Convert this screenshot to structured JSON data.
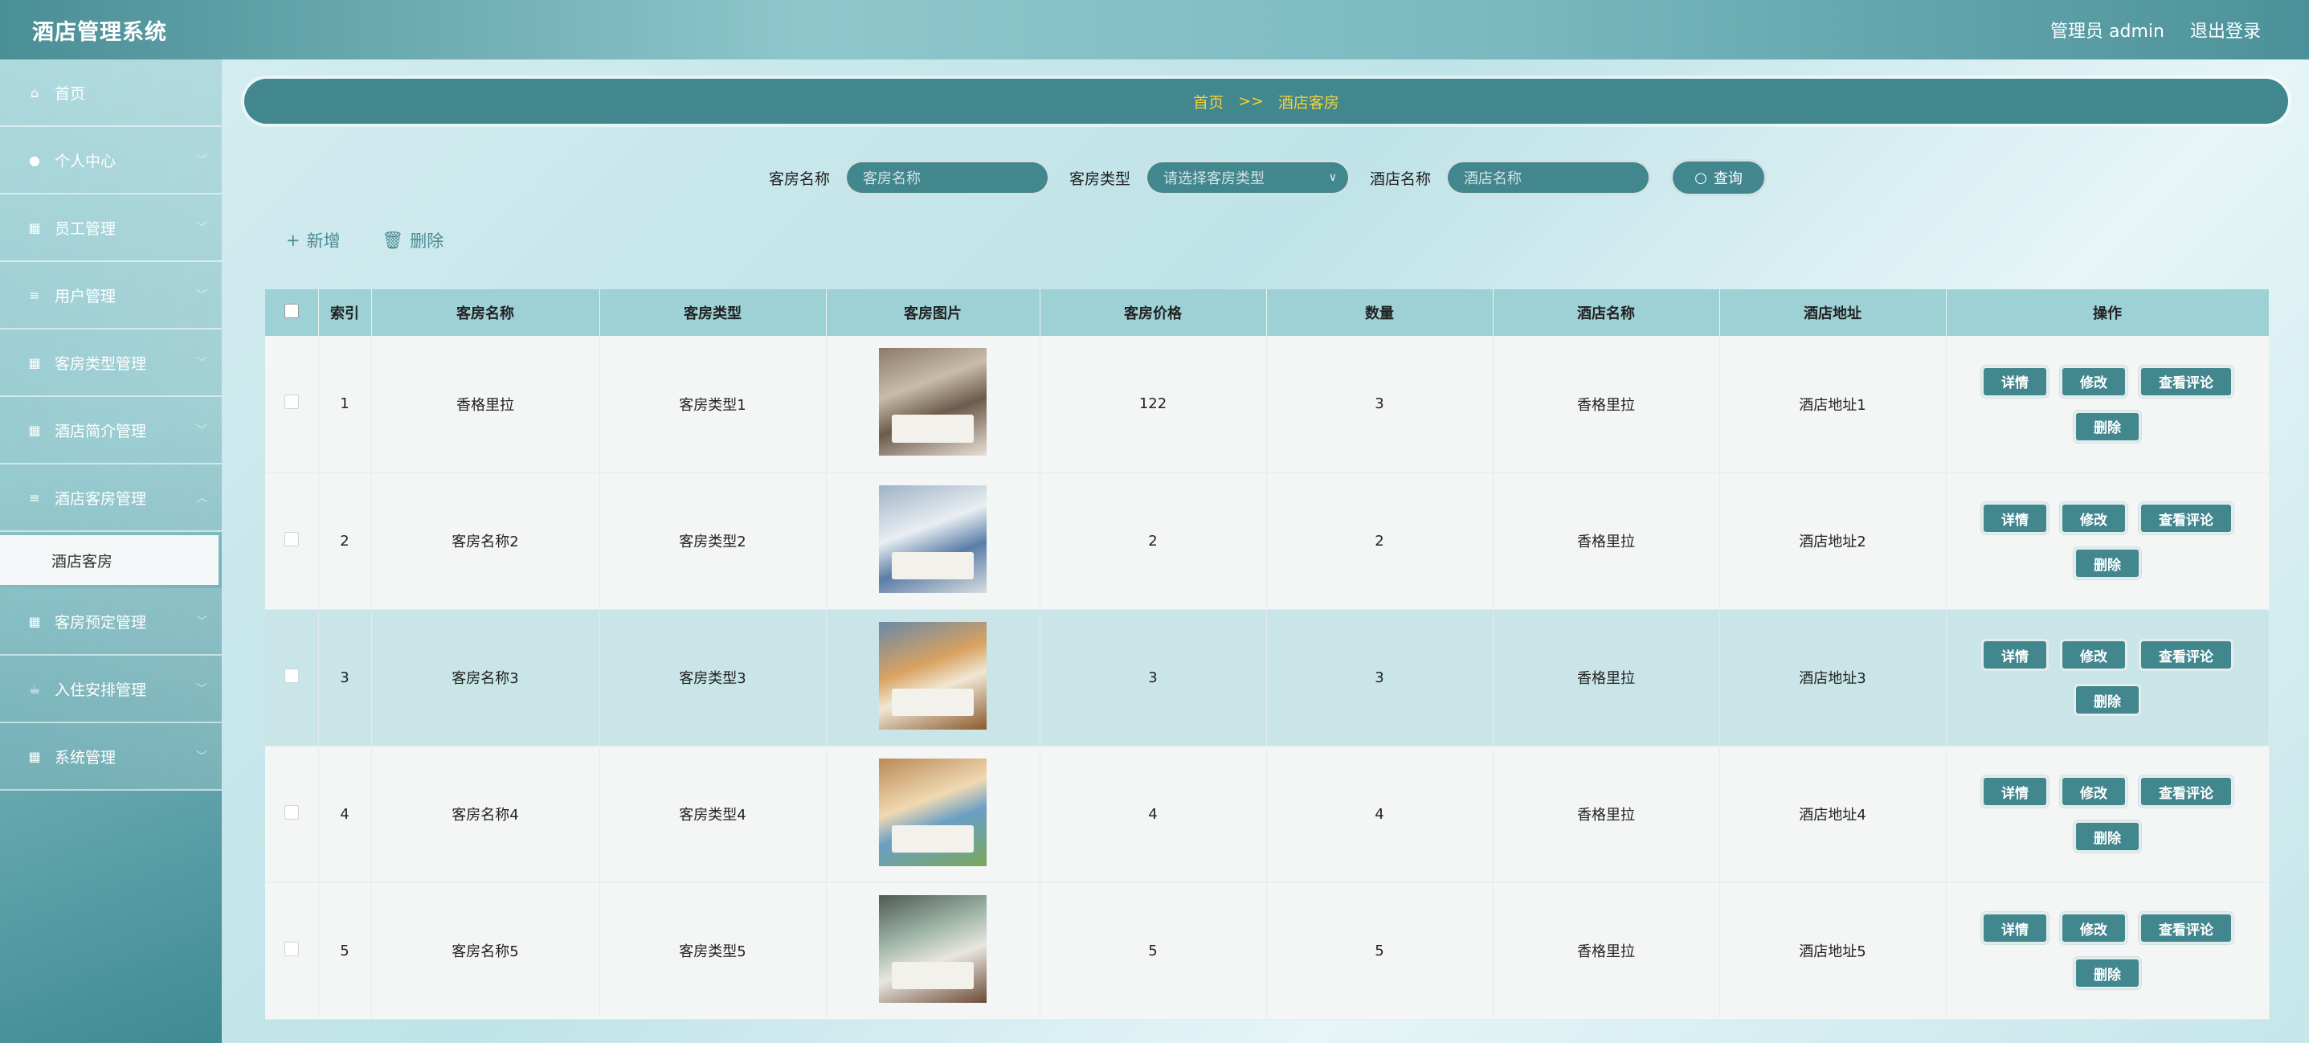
{
  "header": {
    "app_title": "酒店管理系统",
    "user_label": "管理员 admin",
    "logout_label": "退出登录"
  },
  "sidebar": {
    "items": [
      {
        "label": "首页",
        "icon": "home-icon"
      },
      {
        "label": "个人中心",
        "icon": "user-icon"
      },
      {
        "label": "员工管理",
        "icon": "grid-icon"
      },
      {
        "label": "用户管理",
        "icon": "list-icon"
      },
      {
        "label": "客房类型管理",
        "icon": "grid-icon"
      },
      {
        "label": "酒店简介管理",
        "icon": "grid-icon"
      },
      {
        "label": "酒店客房管理",
        "icon": "list-icon"
      },
      {
        "label": "客房预定管理",
        "icon": "grid-icon"
      },
      {
        "label": "入住安排管理",
        "icon": "cup-icon"
      },
      {
        "label": "系统管理",
        "icon": "grid-icon"
      }
    ],
    "active_sub": "酒店客房"
  },
  "breadcrumb": {
    "home": "首页",
    "sep": ">>",
    "current": "酒店客房"
  },
  "search": {
    "room_name_label": "客房名称",
    "room_name_placeholder": "客房名称",
    "room_type_label": "客房类型",
    "room_type_placeholder": "请选择客房类型",
    "hotel_name_label": "酒店名称",
    "hotel_name_placeholder": "酒店名称",
    "query_label": "查询"
  },
  "toolbar": {
    "add_label": "新增",
    "delete_label": "删除"
  },
  "table": {
    "headers": [
      "索引",
      "客房名称",
      "客房类型",
      "客房图片",
      "客房价格",
      "数量",
      "酒店名称",
      "酒店地址",
      "操作"
    ],
    "rows": [
      {
        "index": "1",
        "name": "香格里拉",
        "type": "客房类型1",
        "price": "122",
        "qty": "3",
        "hotel": "香格里拉",
        "addr": "酒店地址1"
      },
      {
        "index": "2",
        "name": "客房名称2",
        "type": "客房类型2",
        "price": "2",
        "qty": "2",
        "hotel": "香格里拉",
        "addr": "酒店地址2"
      },
      {
        "index": "3",
        "name": "客房名称3",
        "type": "客房类型3",
        "price": "3",
        "qty": "3",
        "hotel": "香格里拉",
        "addr": "酒店地址3"
      },
      {
        "index": "4",
        "name": "客房名称4",
        "type": "客房类型4",
        "price": "4",
        "qty": "4",
        "hotel": "香格里拉",
        "addr": "酒店地址4"
      },
      {
        "index": "5",
        "name": "客房名称5",
        "type": "客房类型5",
        "price": "5",
        "qty": "5",
        "hotel": "香格里拉",
        "addr": "酒店地址5"
      }
    ],
    "op_labels": {
      "detail": "详情",
      "edit": "修改",
      "reviews": "查看评论",
      "delete": "删除"
    }
  },
  "colors": {
    "primary": "#42868e",
    "header_bg": "#9ed1d6",
    "highlight_row": "#c9e5e8",
    "breadcrumb_text": "#f6d23a"
  }
}
